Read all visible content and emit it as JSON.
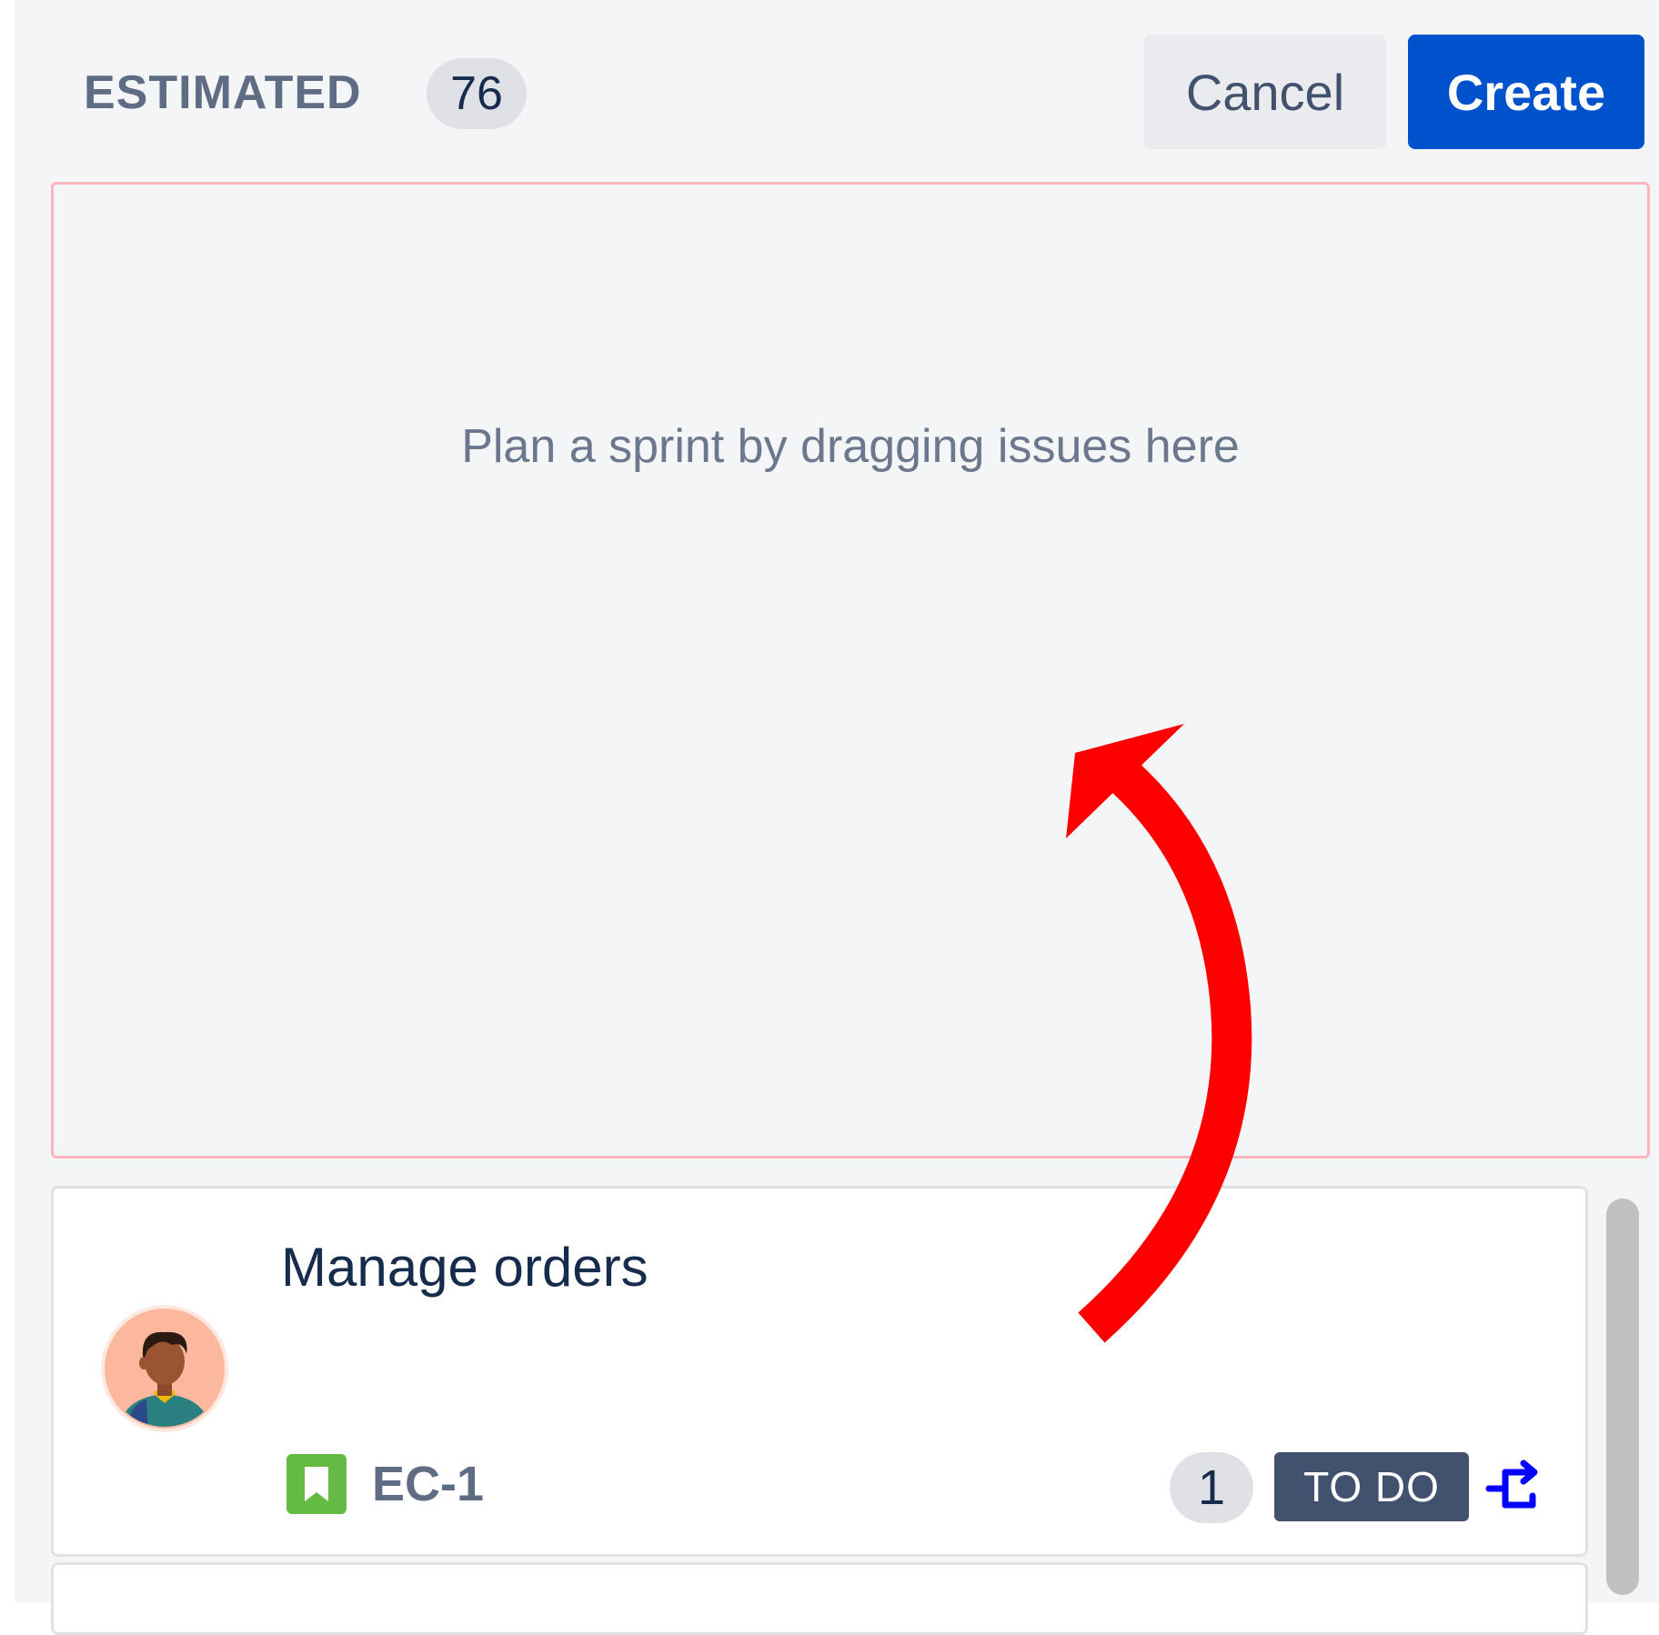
{
  "header": {
    "estimated_label": "ESTIMATED",
    "estimated_count": "76",
    "cancel_label": "Cancel",
    "create_label": "Create"
  },
  "dropzone": {
    "hint": "Plan a sprint by dragging issues here"
  },
  "issue": {
    "title": "Manage orders",
    "key": "EC-1",
    "story_points": "1",
    "status": "TO DO",
    "type_icon": "story-icon",
    "priority_icon": "priority-icon"
  },
  "colors": {
    "primary": "#0052cc",
    "annotation_arrow": "#ff0000",
    "story": "#65ba43",
    "status_bg": "#42526e"
  }
}
